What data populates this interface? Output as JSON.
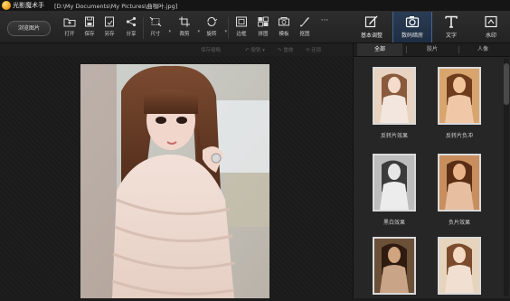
{
  "app": {
    "title": "光影魔术手",
    "file_path": "[D:\\My Documents\\My Pictures\\曲咖叶.jpg]"
  },
  "toolbar": {
    "open_label": "浏览图片",
    "items": [
      {
        "label": "打开",
        "icon": "open-icon"
      },
      {
        "label": "保存",
        "icon": "save-icon"
      },
      {
        "label": "另存",
        "icon": "save-as-icon"
      },
      {
        "label": "分享",
        "icon": "share-icon"
      },
      {
        "label": "尺寸",
        "icon": "resize-icon"
      },
      {
        "label": "裁剪",
        "icon": "crop-icon"
      },
      {
        "label": "旋转",
        "icon": "rotate-icon"
      },
      {
        "label": "边框",
        "icon": "frame-icon"
      },
      {
        "label": "拼图",
        "icon": "collage-icon"
      },
      {
        "label": "模板",
        "icon": "template-icon"
      },
      {
        "label": "抠图",
        "icon": "cutout-icon"
      },
      {
        "label": "···",
        "icon": "more-icon"
      }
    ],
    "modes": [
      {
        "label": "基本调整",
        "icon": "adjust-icon"
      },
      {
        "label": "数码暗房",
        "icon": "camera-icon"
      },
      {
        "label": "文字",
        "icon": "text-icon"
      },
      {
        "label": "水印",
        "icon": "watermark-icon"
      }
    ]
  },
  "subbar": {
    "compare": "保存缩略",
    "undo": "撤销",
    "redo": "重做",
    "restore": "还原"
  },
  "side_panel": {
    "tabs": [
      "全部",
      "胶片",
      "人像"
    ],
    "effects": [
      {
        "label": "反转片效果"
      },
      {
        "label": "反转片负冲"
      },
      {
        "label": "黑白效果"
      },
      {
        "label": "负片效果"
      },
      {
        "label": ""
      },
      {
        "label": ""
      }
    ]
  },
  "colors": {
    "accent": "#2a3c55",
    "background": "#1c1c1c",
    "panel": "#262626"
  }
}
